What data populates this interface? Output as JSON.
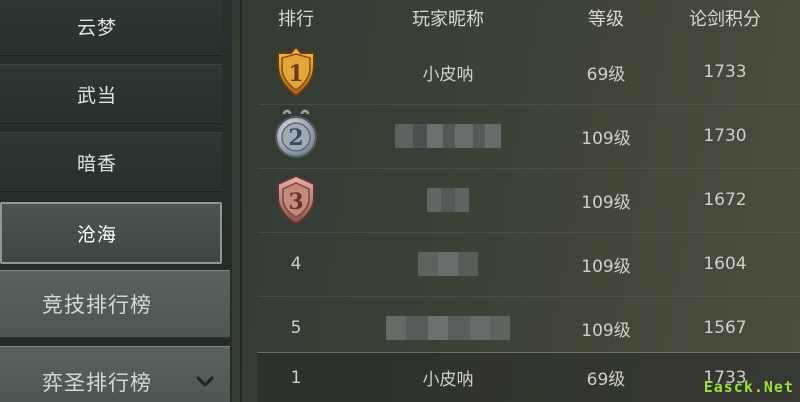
{
  "sidebar": {
    "sub_tabs": [
      {
        "label": "云梦"
      },
      {
        "label": "武当"
      },
      {
        "label": "暗香"
      },
      {
        "label": "沧海"
      }
    ],
    "category_tabs": [
      {
        "label": "竞技排行榜"
      },
      {
        "label": "弈圣排行榜"
      }
    ]
  },
  "table": {
    "headers": {
      "rank": "排行",
      "name": "玩家昵称",
      "level": "等级",
      "score": "论剑积分"
    },
    "rows": [
      {
        "rank": "1",
        "name": "小皮呐",
        "level": "69级",
        "score": "1733",
        "medal": "gold-medal-icon"
      },
      {
        "rank": "2",
        "name": "",
        "level": "109级",
        "score": "1730",
        "medal": "silver-medal-icon"
      },
      {
        "rank": "3",
        "name": "",
        "level": "109级",
        "score": "1672",
        "medal": "bronze-medal-icon"
      },
      {
        "rank": "4",
        "name": "",
        "level": "109级",
        "score": "1604"
      },
      {
        "rank": "5",
        "name": "",
        "level": "109级",
        "score": "1567"
      }
    ],
    "my_row": {
      "rank": "1",
      "name": "小皮呐",
      "level": "69级",
      "score": "1733"
    }
  },
  "watermark": "Easck.Net",
  "colors": {
    "active_tab_border": "#8d9894",
    "gold": "#d9992b",
    "silver": "#aab4be",
    "bronze": "#c08078",
    "watermark": "#9fdc43"
  }
}
